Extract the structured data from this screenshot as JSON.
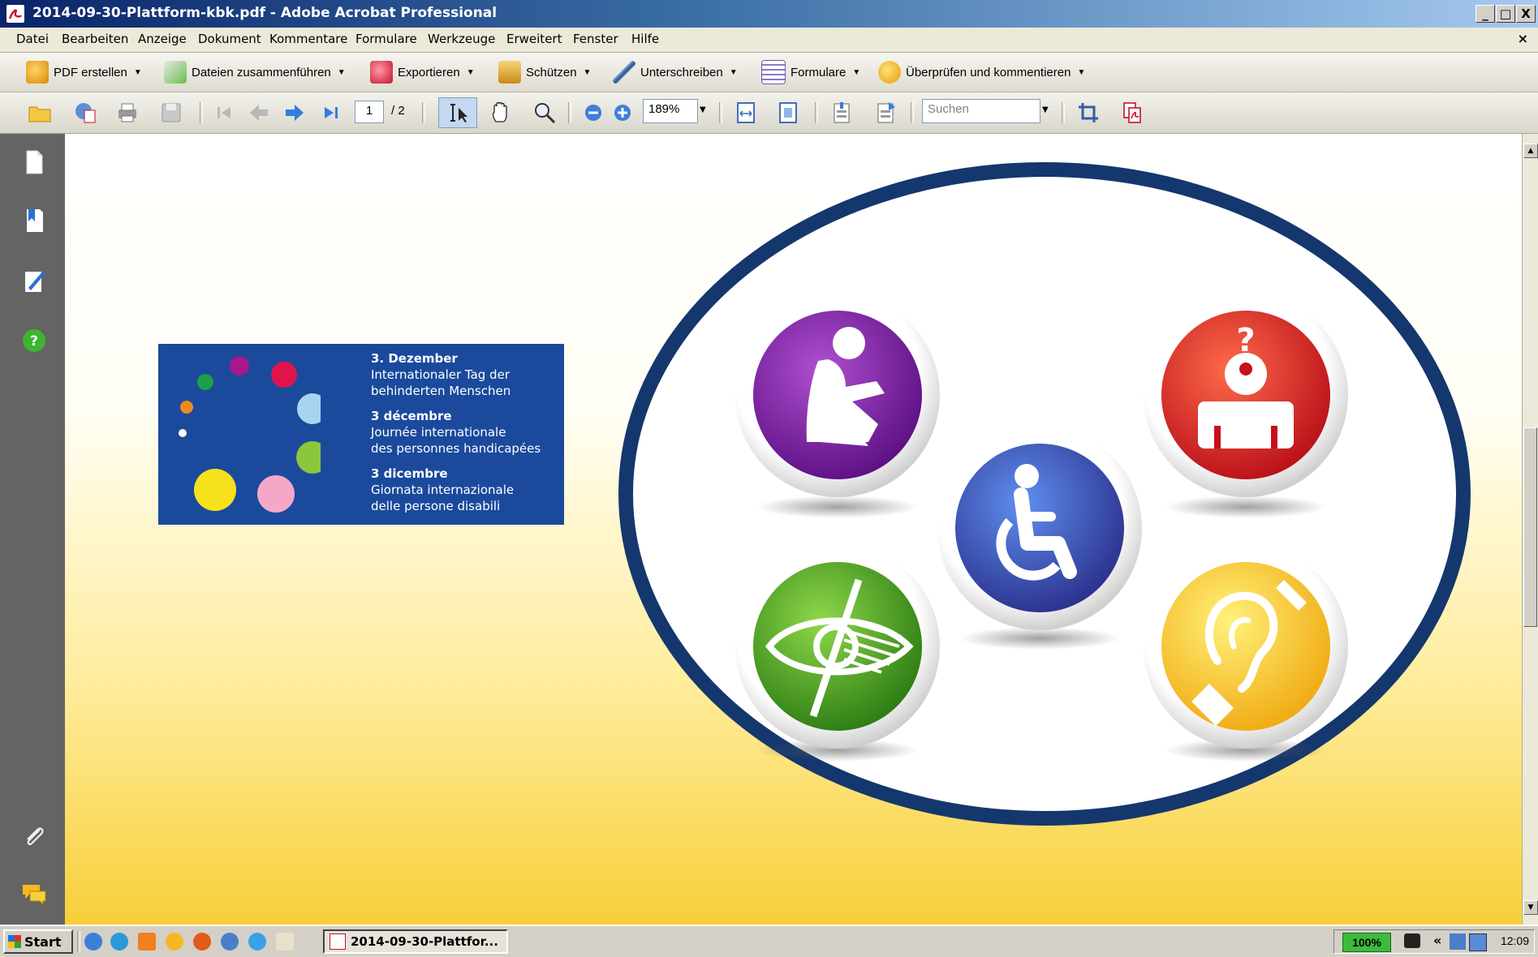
{
  "window": {
    "title": "2014-09-30-Plattform-kbk.pdf - Adobe Acrobat Professional",
    "controls": [
      "_",
      "□",
      "X"
    ]
  },
  "menu": {
    "items": [
      "Datei",
      "Bearbeiten",
      "Anzeige",
      "Dokument",
      "Kommentare",
      "Formulare",
      "Werkzeuge",
      "Erweitert",
      "Fenster",
      "Hilfe"
    ],
    "close": "×"
  },
  "task_toolbar": {
    "pdf_erstellen": "PDF erstellen",
    "dateien_zusammenfuehren": "Dateien zusammenführen",
    "exportieren": "Exportieren",
    "schuetzen": "Schützen",
    "unterschreiben": "Unterschreiben",
    "formulare": "Formulare",
    "ueberpruefen": "Überprüfen und kommentieren"
  },
  "tools_toolbar": {
    "current_page": "1",
    "page_total": "/ 2",
    "zoom": "189%",
    "search_placeholder": "Suchen"
  },
  "banner": {
    "dots": [
      {
        "color": "#e0144b"
      },
      {
        "color": "#a8178c"
      },
      {
        "color": "#1e9e46"
      },
      {
        "color": "#f08a1e"
      },
      {
        "color": "#ffffff"
      },
      {
        "color": "#a8d4f2"
      },
      {
        "color": "#8cc63e"
      },
      {
        "color": "#f7e11c"
      },
      {
        "color": "#f4a8c8"
      }
    ],
    "lines": [
      {
        "heading": "3. Dezember",
        "text": [
          "Internationaler Tag der",
          "behinderten Menschen"
        ]
      },
      {
        "heading": "3 décembre",
        "text": [
          "Journée internationale",
          "des personnes handicapées"
        ]
      },
      {
        "heading": "3 dicembre",
        "text": [
          "Giornata internazionale",
          "delle persone disabili"
        ]
      }
    ]
  },
  "illustration": {
    "ellipse_color": "#14376e",
    "badges": [
      {
        "name": "psychological-disability",
        "color": "#7b1fa2"
      },
      {
        "name": "cognitive-disability",
        "color": "#d81b23"
      },
      {
        "name": "wheelchair",
        "color": "#2f3f9e"
      },
      {
        "name": "visual-impairment",
        "color": "#3f9a23"
      },
      {
        "name": "hearing-impairment",
        "color": "#f0c020"
      }
    ]
  },
  "taskbar": {
    "start": "Start",
    "task": "2014-09-30-Plattfor...",
    "battery": "100%",
    "clock": "12:09",
    "tray_prefix": "«"
  }
}
